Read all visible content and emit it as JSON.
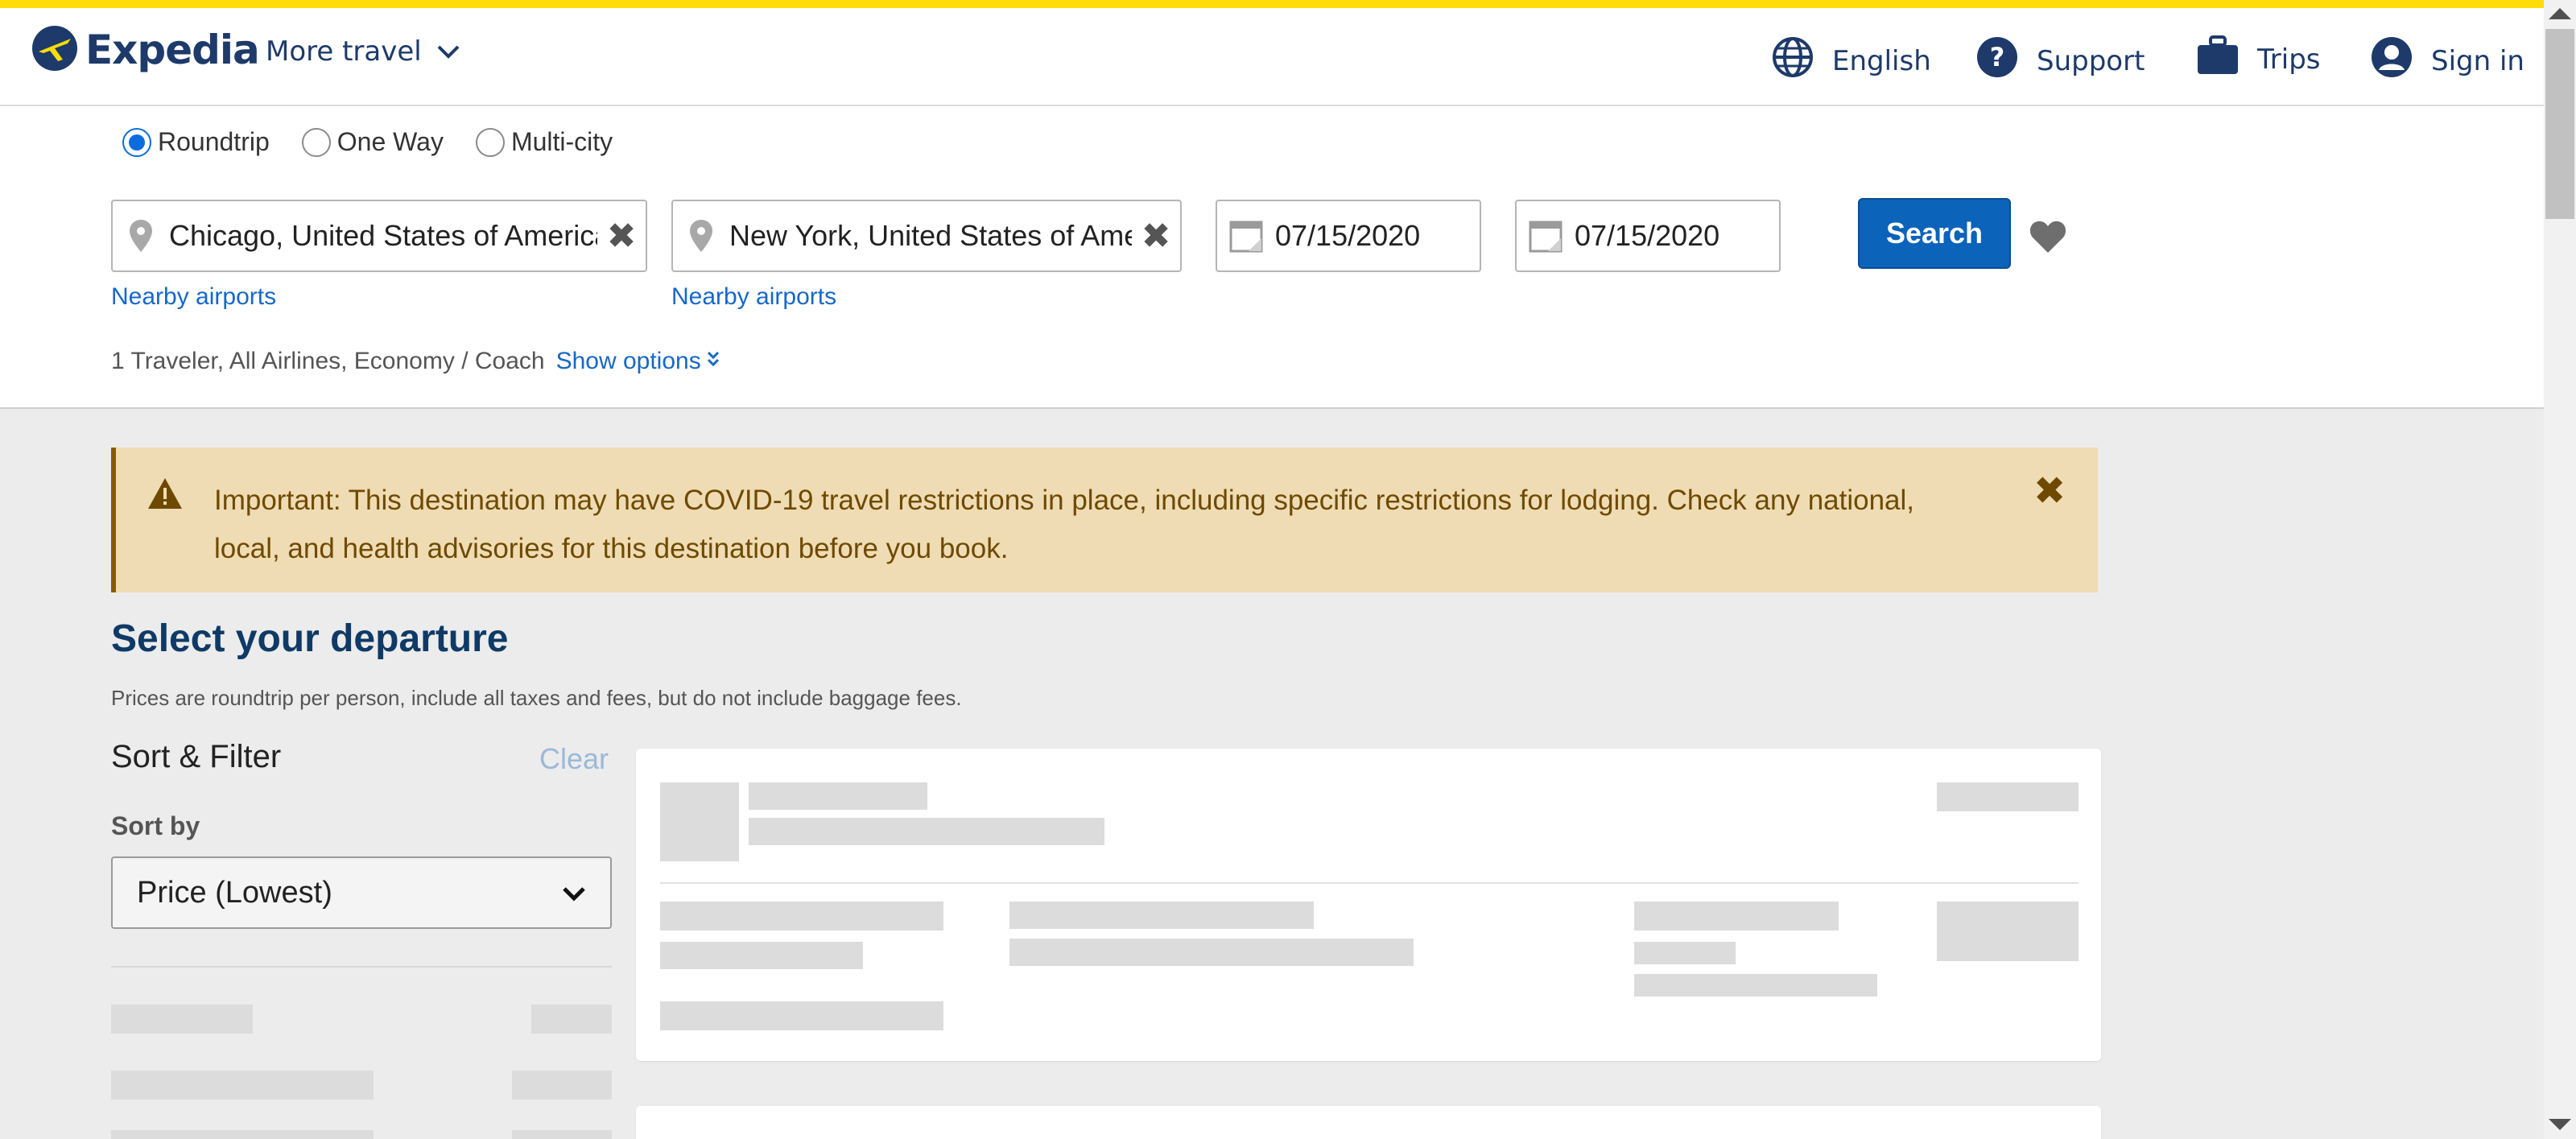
{
  "header": {
    "brand": "Expedia",
    "more_travel": "More travel",
    "language": "English",
    "support": "Support",
    "trips": "Trips",
    "sign_in": "Sign in"
  },
  "trip_type": {
    "options": [
      "Roundtrip",
      "One Way",
      "Multi-city"
    ],
    "selected": "Roundtrip"
  },
  "search": {
    "origin": "Chicago, United States of America",
    "destination": "New York, United States of America",
    "depart_date": "07/15/2020",
    "return_date": "07/15/2020",
    "nearby_airports": "Nearby airports",
    "search_label": "Search",
    "travelers_summary": "1 Traveler, All Airlines, Economy / Coach",
    "show_options": "Show options"
  },
  "alert": {
    "text": "Important: This destination may have COVID-19 travel restrictions in place, including specific restrictions for lodging. Check any national, local, and health advisories for this destination before you book."
  },
  "results": {
    "title": "Select your departure",
    "subtitle": "Prices are roundtrip per person, include all taxes and fees, but do not include baggage fees."
  },
  "filters": {
    "title": "Sort & Filter",
    "clear": "Clear",
    "sort_by_label": "Sort by",
    "sort_value": "Price (Lowest)"
  },
  "colors": {
    "accent": "#fedc07",
    "brand_navy": "#1d3a6a",
    "link_blue": "#1668c8",
    "button_blue": "#0b63ba",
    "alert_bg": "#efdcb4"
  }
}
